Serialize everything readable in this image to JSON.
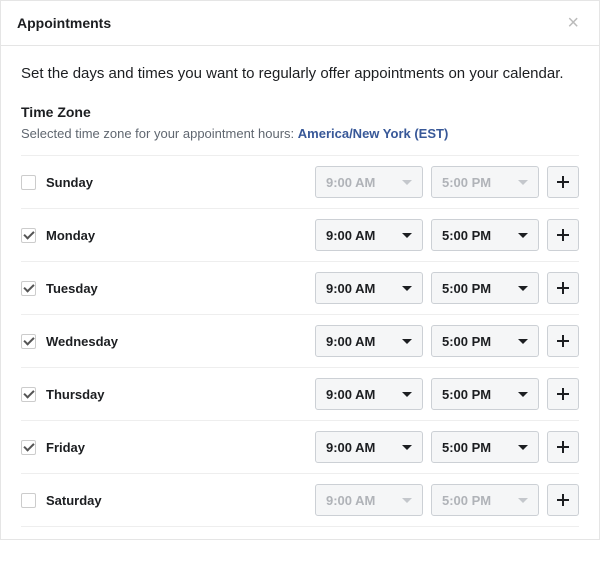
{
  "header": {
    "title": "Appointments"
  },
  "intro": "Set the days and times you want to regularly offer appointments on your calendar.",
  "timezone": {
    "label": "Time Zone",
    "subtext": "Selected time zone for your appointment hours: ",
    "value": "America/New York (EST)"
  },
  "days": [
    {
      "name": "Sunday",
      "checked": false,
      "start": "9:00 AM",
      "end": "5:00 PM"
    },
    {
      "name": "Monday",
      "checked": true,
      "start": "9:00 AM",
      "end": "5:00 PM"
    },
    {
      "name": "Tuesday",
      "checked": true,
      "start": "9:00 AM",
      "end": "5:00 PM"
    },
    {
      "name": "Wednesday",
      "checked": true,
      "start": "9:00 AM",
      "end": "5:00 PM"
    },
    {
      "name": "Thursday",
      "checked": true,
      "start": "9:00 AM",
      "end": "5:00 PM"
    },
    {
      "name": "Friday",
      "checked": true,
      "start": "9:00 AM",
      "end": "5:00 PM"
    },
    {
      "name": "Saturday",
      "checked": false,
      "start": "9:00 AM",
      "end": "5:00 PM"
    }
  ]
}
